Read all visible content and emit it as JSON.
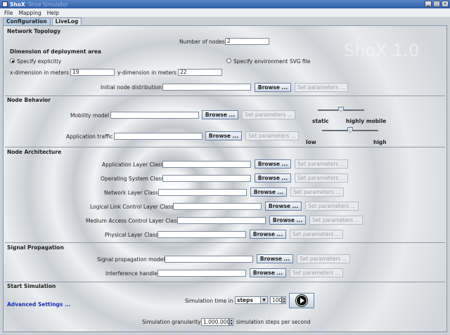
{
  "window": {
    "title": "ShoX",
    "subtitle": "Shoe Simulator",
    "icons": [
      "minimize-icon",
      "maximize-icon",
      "close-icon"
    ]
  },
  "menu": [
    "File",
    "Mapping",
    "Help"
  ],
  "tabs": [
    "Configuration",
    "LiveLog"
  ],
  "watermark": "ShoX 1.0",
  "network": {
    "title": "Network Topology",
    "nodes_label": "Number of nodes",
    "nodes_value": "2",
    "dimension_title": "Dimension of deployment area",
    "radio_explicit": "Specify explicitly",
    "radio_svg": "Specify environment SVG file",
    "x_label": "x-dimension in meters",
    "x_value": "19",
    "y_label": "y-dimension in meters",
    "y_value": "22",
    "dist_label": "Initial node distribution",
    "dist_value": ""
  },
  "behavior": {
    "title": "Node Behavior",
    "mobility_label": "Mobility model",
    "mobility_value": "",
    "app_label": "Application traffic",
    "app_value": "",
    "static_label": "static",
    "mobile_label": "highly mobile",
    "low_label": "low",
    "high_label": "high",
    "mobility_level": 0.5,
    "traffic_level": 0.5
  },
  "architecture": {
    "title": "Node Architecture",
    "layers": [
      {
        "label": "Application Layer Class",
        "value": ""
      },
      {
        "label": "Operating System Class",
        "value": ""
      },
      {
        "label": "Network Layer Class",
        "value": ""
      },
      {
        "label": "Logical Link Control Layer Class",
        "value": ""
      },
      {
        "label": "Medium Access Control Layer Class",
        "value": ""
      },
      {
        "label": "Physical Layer Class",
        "value": ""
      }
    ]
  },
  "propagation": {
    "title": "Signal Propagation",
    "model_label": "Signal propagation model",
    "model_value": "",
    "interference_label": "Interference handler",
    "interference_value": ""
  },
  "simulation": {
    "title": "Start Simulation",
    "advanced_link": "Advanced Settings ...",
    "time_label": "Simulation time in",
    "time_unit": "steps",
    "time_value": "100",
    "granularity_label": "Simulation granularity",
    "granularity_value": "1.000.000",
    "granularity_unit": "simulation steps per second"
  },
  "buttons": {
    "browse": "Browse ...",
    "set_params": "Set parameters ..."
  },
  "colors": {
    "titlebar": "#2e5ea8",
    "link": "#1a2fb0",
    "disabled_text": "#9aa1a9"
  }
}
